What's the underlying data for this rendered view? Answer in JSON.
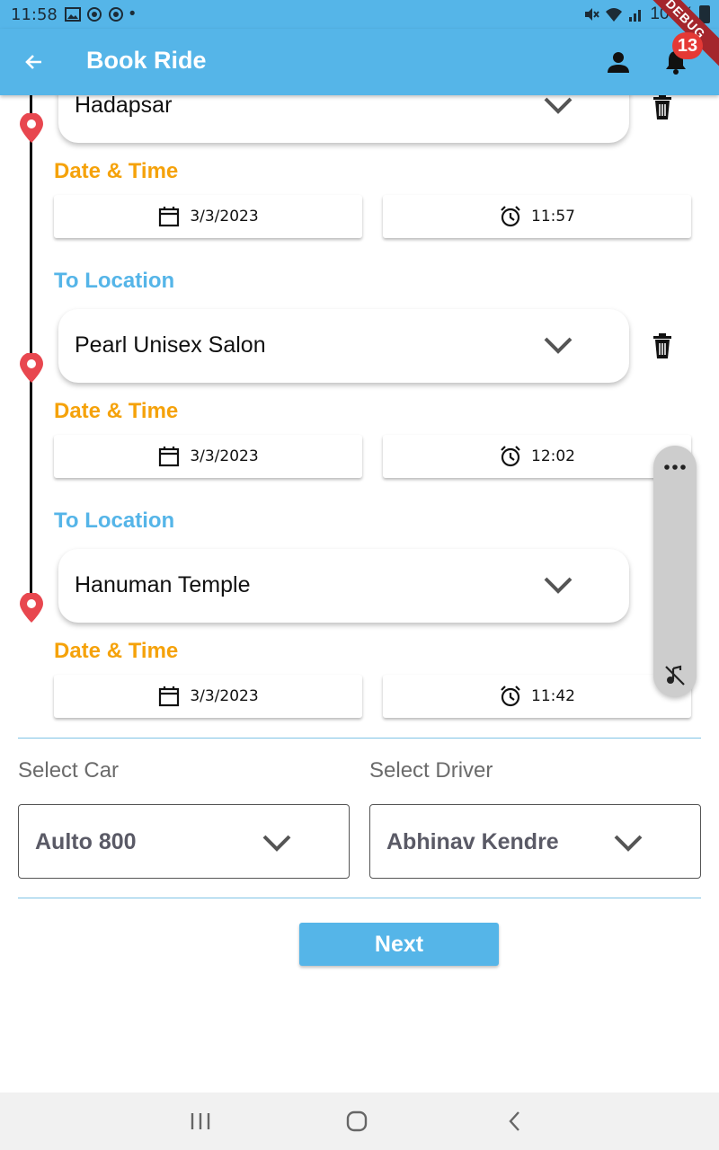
{
  "status_bar": {
    "time": "11:58",
    "battery": "100%",
    "dot": "•"
  },
  "app_bar": {
    "title": "Book Ride",
    "notification_count": "13",
    "debug_label": "DEBUG"
  },
  "stops": [
    {
      "location": "Hadapsar",
      "datetime_label": "Date & Time",
      "date": "3/3/2023",
      "time": "11:57"
    },
    {
      "section_label": "To Location",
      "location": "Pearl Unisex Salon",
      "datetime_label": "Date & Time",
      "date": "3/3/2023",
      "time": "12:02"
    },
    {
      "section_label": "To Location",
      "location": "Hanuman Temple",
      "datetime_label": "Date & Time",
      "date": "3/3/2023",
      "time": "11:42"
    }
  ],
  "car": {
    "label": "Select Car",
    "value": "Aulto 800"
  },
  "driver": {
    "label": "Select Driver",
    "value": "Abhinav Kendre"
  },
  "next_button": "Next",
  "colors": {
    "primary": "#55b5e8",
    "accent_orange": "#f5a20a",
    "pin_red": "#e8474f"
  }
}
